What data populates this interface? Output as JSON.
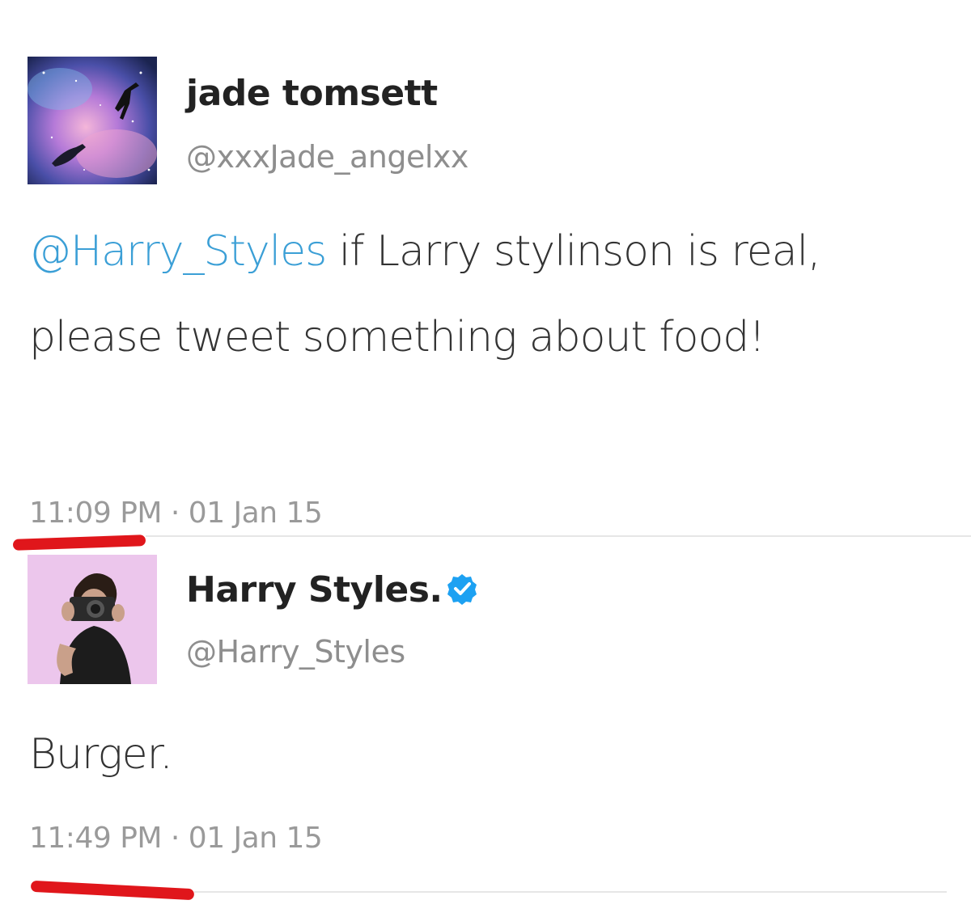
{
  "tweets": [
    {
      "display_name": "jade tomsett",
      "handle": "@xxxJade_angelxx",
      "mention": "@Harry_Styles",
      "text": " if Larry stylinson is real, please tweet something about food!",
      "timestamp": "11:09 PM · 01 Jan 15",
      "avatar_icon": "galaxy-peter-pan-avatar"
    },
    {
      "display_name": "Harry Styles.",
      "handle": "@Harry_Styles",
      "text": "Burger.",
      "timestamp": "11:49 PM · 01 Jan 15",
      "verified": true,
      "avatar_icon": "camera-photo-avatar"
    }
  ],
  "colors": {
    "mention": "#3b9fd6",
    "verified": "#1da1f2",
    "annotation": "#e0161b",
    "muted": "#9a9a9a"
  }
}
